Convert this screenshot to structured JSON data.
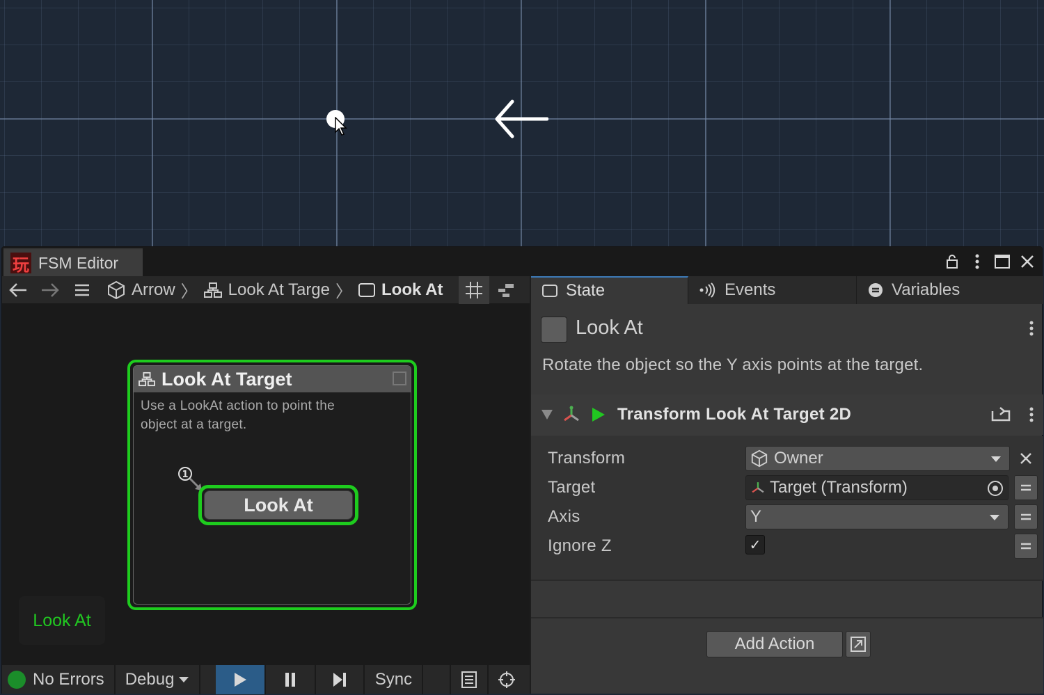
{
  "window": {
    "title": "FSM Editor",
    "app_icon_glyph": "玩"
  },
  "breadcrumb": {
    "items": [
      "Arrow",
      "Look At Targe",
      "Look At"
    ]
  },
  "group_node": {
    "title": "Look At Target",
    "description": "Use a LookAt action to point the object at a target."
  },
  "state_node": {
    "label": "Look At",
    "start_marker": "1"
  },
  "active_state_label": "Look At",
  "status_bar": {
    "errors": "No Errors",
    "debug": "Debug",
    "sync": "Sync"
  },
  "inspector": {
    "tabs": [
      "State",
      "Events",
      "Variables"
    ],
    "state_name": "Look At",
    "state_description": "Rotate the object so the Y axis points at the target.",
    "action": {
      "title": "Transform Look At Target 2D",
      "properties": [
        {
          "label": "Transform",
          "value": "Owner"
        },
        {
          "label": "Target",
          "value": "Target (Transform)"
        },
        {
          "label": "Axis",
          "value": "Y"
        },
        {
          "label": "Ignore Z",
          "value": "✓"
        }
      ]
    },
    "add_action_label": "Add Action"
  },
  "colors": {
    "accent_green": "#1ecc1e",
    "active_label_green": "#21c721",
    "play_button_blue": "#2b5c88",
    "status_ok_green": "#1b8d2a"
  }
}
